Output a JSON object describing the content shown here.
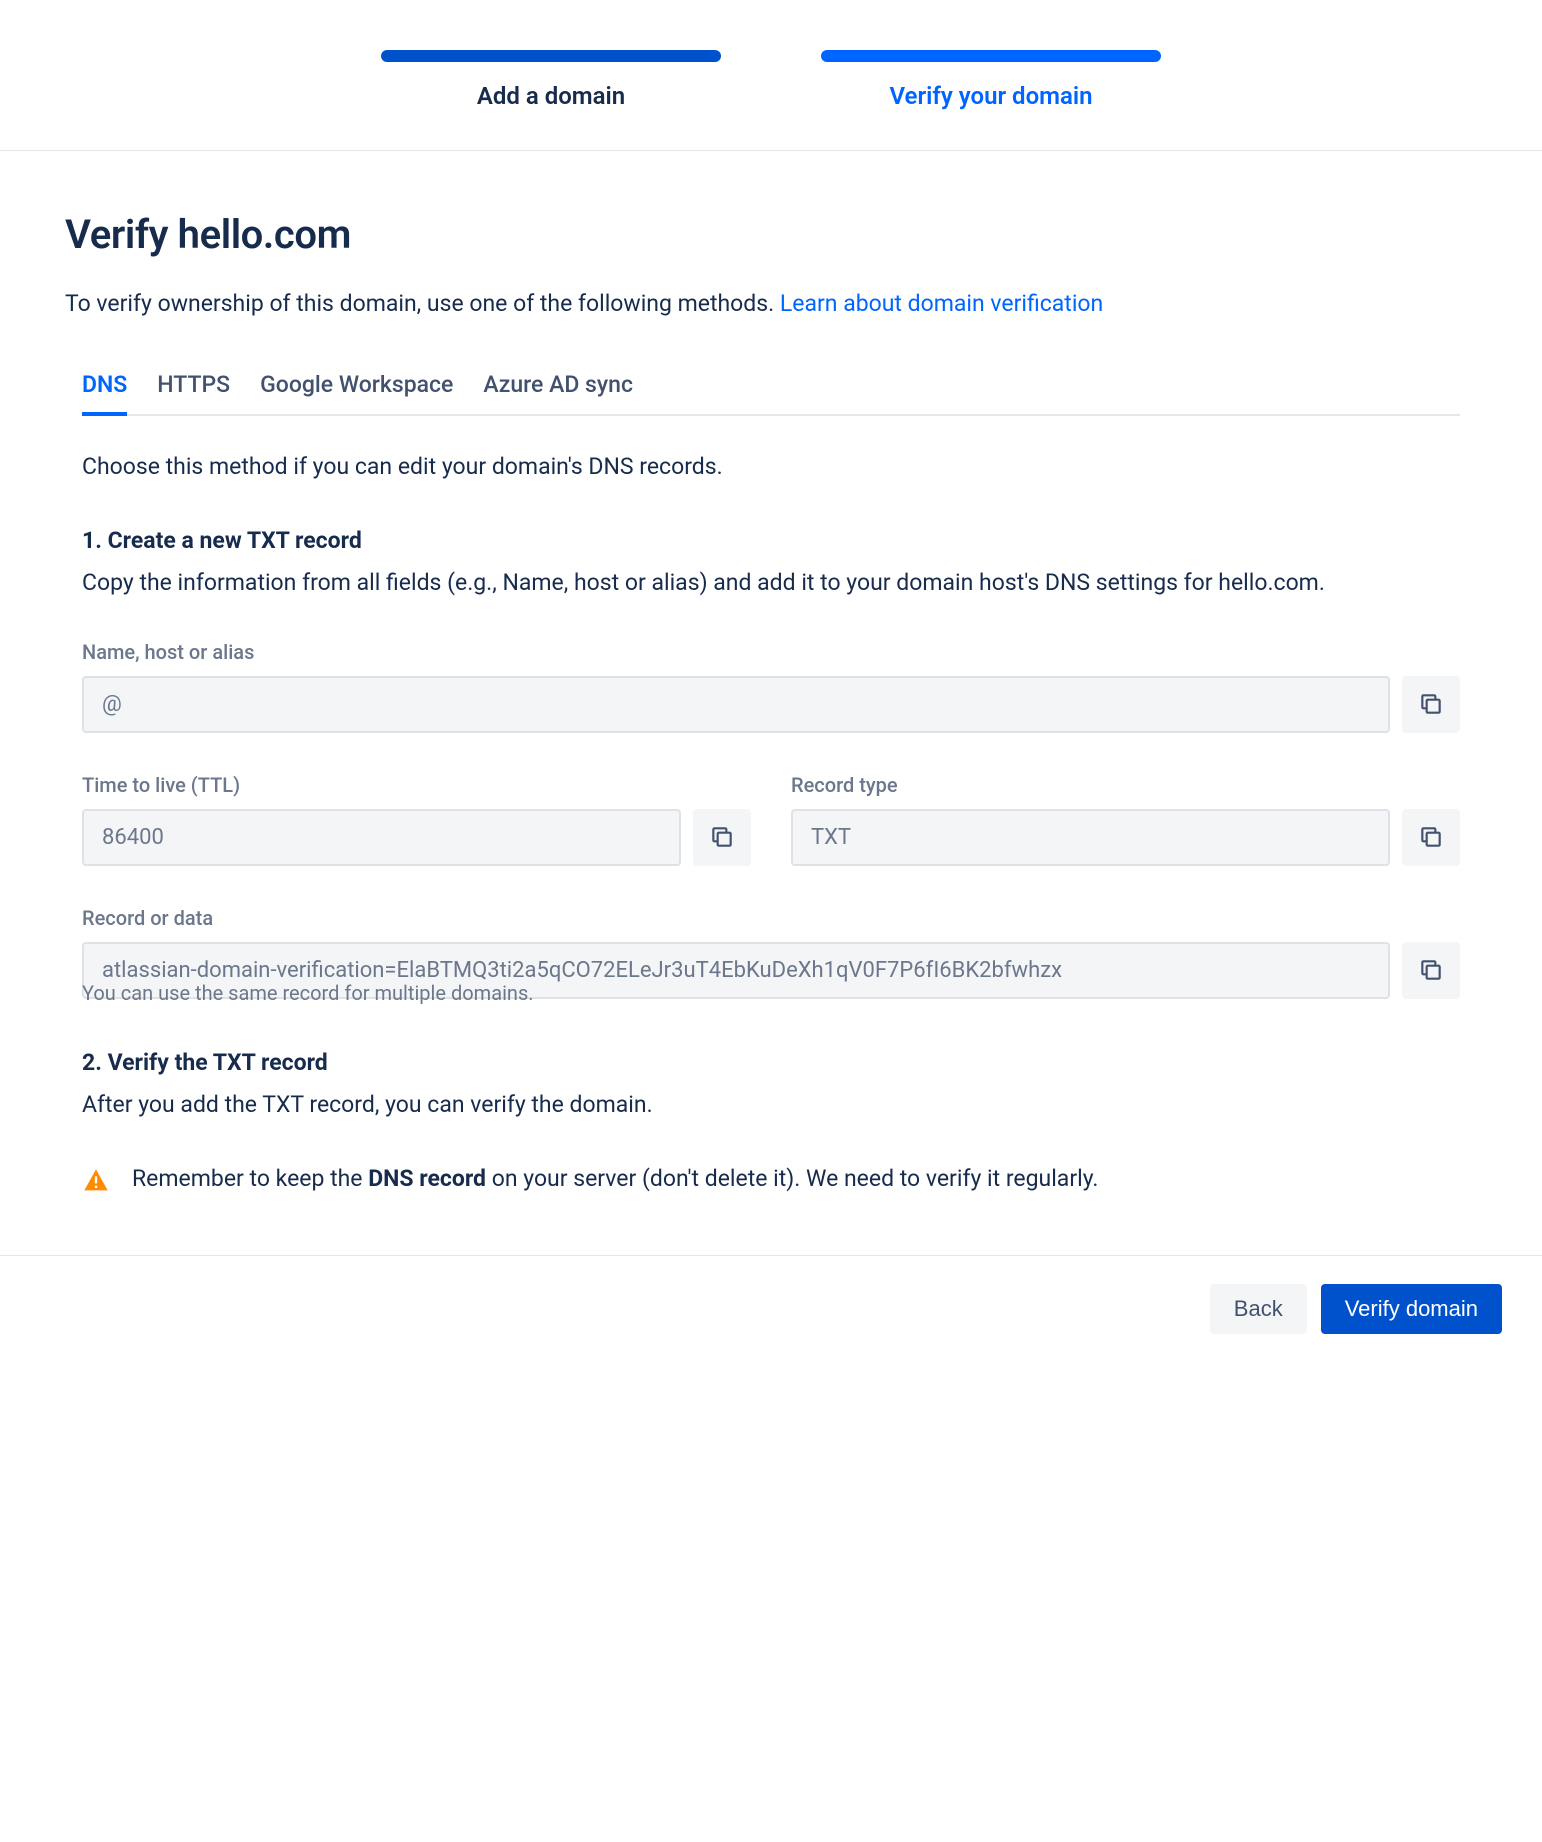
{
  "stepper": {
    "step1_label": "Add a domain",
    "step2_label": "Verify your domain"
  },
  "title": "Verify hello.com",
  "subtitle_text": "To verify ownership of this domain, use one of the following methods. ",
  "subtitle_link": "Learn about domain verification",
  "tabs": {
    "dns": "DNS",
    "https": "HTTPS",
    "google": "Google Workspace",
    "azure": "Azure AD sync"
  },
  "method_desc": "Choose this method if you can edit your domain's DNS records.",
  "step1": {
    "heading": "1. Create a new TXT record",
    "body": "Copy the information from all fields (e.g., Name, host or alias) and add it to your domain host's DNS settings for hello.com."
  },
  "fields": {
    "name_label": "Name, host or alias",
    "name_value": "@",
    "ttl_label": "Time to live (TTL)",
    "ttl_value": "86400",
    "type_label": "Record type",
    "type_value": "TXT",
    "data_label": "Record or data",
    "data_value": "atlassian-domain-verification=ElaBTMQ3ti2a5qCO72ELeJr3uT4EbKuDeXh1qV0F7P6fI6BK2bfwhzx",
    "data_helper": "You can use the same record for multiple domains."
  },
  "step2": {
    "heading": "2. Verify the TXT record",
    "body": "After you add the TXT record, you can verify the domain."
  },
  "callout": {
    "pre": "Remember to keep the ",
    "bold": "DNS record",
    "post": " on your server (don't delete it). We need to verify it regularly."
  },
  "footer": {
    "back": "Back",
    "verify": "Verify domain"
  }
}
